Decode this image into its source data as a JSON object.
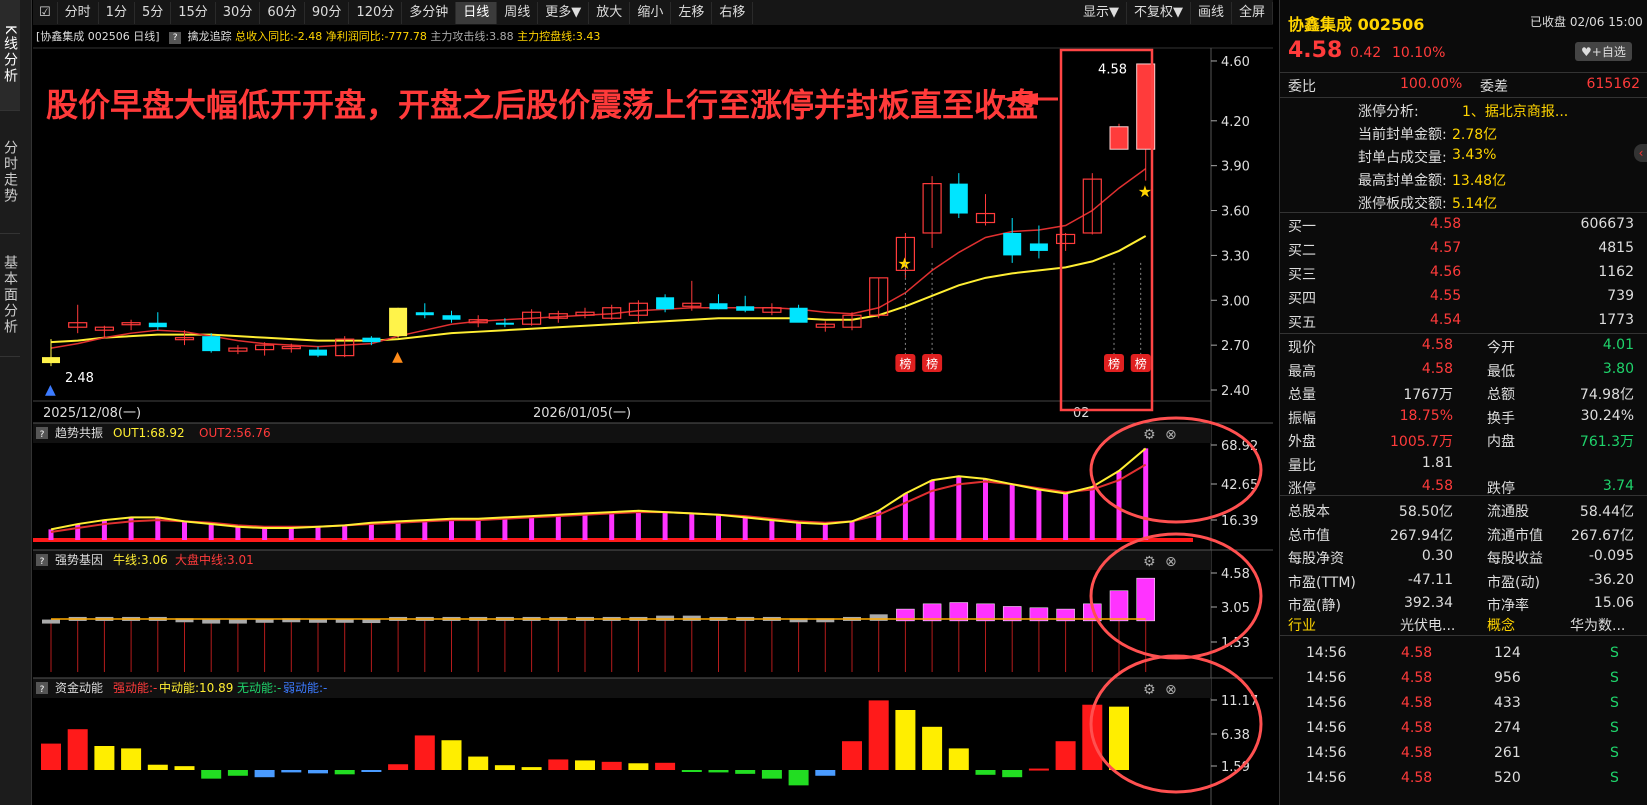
{
  "left_tabs": [
    "K线分析",
    "分时走势",
    "基本面分析"
  ],
  "toolbar": [
    "分时",
    "1分",
    "5分",
    "15分",
    "30分",
    "60分",
    "90分",
    "120分",
    "多分钟",
    "日线",
    "周线",
    "更多▼",
    "放大",
    "缩小",
    "左移",
    "右移"
  ],
  "toolbar_right": [
    "显示▼",
    "不复权▼",
    "画线",
    "全屏"
  ],
  "info": {
    "title": "[协鑫集成 002506 日线]",
    "indicator": "擒龙追踪",
    "t1": "总收入同比:-2.48",
    "t2": "净利润同比:-777.78",
    "t3": "主力攻击线:3.88",
    "t4": "主力控盘线:3.43"
  },
  "annotation": "股价早盘大幅低开开盘，开盘之后股价震荡上行至涨停并封板直至收盘",
  "price_axis": [
    "4.60",
    "4.20",
    "3.90",
    "3.60",
    "3.30",
    "3.00",
    "2.70",
    "2.40"
  ],
  "date_axis": [
    "2025/12/08(一)",
    "2026/01/05(一)",
    "02"
  ],
  "labels": {
    "low": "2.48",
    "high": "4.58",
    "bang": "榜"
  },
  "panels": [
    {
      "title": "趋势共振",
      "l1": "OUT1:68.92",
      "l2": "OUT2:56.76",
      "axis": [
        "68.92",
        "42.65",
        "16.39"
      ]
    },
    {
      "title": "强势基因",
      "l1": "牛线:3.06",
      "l2": "大盘中线:3.01",
      "axis": [
        "4.58",
        "3.05",
        "1.53"
      ]
    },
    {
      "title": "资金动能",
      "l1": "强动能:-",
      "l2": "中动能:10.89",
      "l3": "无动能:-",
      "l4": "弱动能:-",
      "axis": [
        "11.17",
        "6.38",
        "1.59"
      ]
    }
  ],
  "chart_data": {
    "type": "candlestick",
    "title": "协鑫集成 002506 日线",
    "candles": [
      [
        2.62,
        2.74,
        2.56,
        2.58
      ],
      [
        2.82,
        2.97,
        2.78,
        2.85
      ],
      [
        2.8,
        2.83,
        2.75,
        2.82
      ],
      [
        2.84,
        2.87,
        2.8,
        2.85
      ],
      [
        2.85,
        2.92,
        2.8,
        2.82
      ],
      [
        2.75,
        2.8,
        2.7,
        2.75
      ],
      [
        2.76,
        2.78,
        2.65,
        2.66
      ],
      [
        2.66,
        2.7,
        2.64,
        2.68
      ],
      [
        2.67,
        2.72,
        2.63,
        2.7
      ],
      [
        2.68,
        2.71,
        2.65,
        2.69
      ],
      [
        2.67,
        2.69,
        2.62,
        2.63
      ],
      [
        2.63,
        2.76,
        2.62,
        2.74
      ],
      [
        2.75,
        2.76,
        2.7,
        2.72
      ],
      [
        2.76,
        2.95,
        2.75,
        2.95
      ],
      [
        2.92,
        2.98,
        2.88,
        2.9
      ],
      [
        2.9,
        2.93,
        2.85,
        2.87
      ],
      [
        2.85,
        2.9,
        2.82,
        2.87
      ],
      [
        2.85,
        2.88,
        2.82,
        2.84
      ],
      [
        2.84,
        2.94,
        2.83,
        2.92
      ],
      [
        2.88,
        2.93,
        2.85,
        2.91
      ],
      [
        2.9,
        2.95,
        2.88,
        2.92
      ],
      [
        2.88,
        2.97,
        2.87,
        2.95
      ],
      [
        2.9,
        3.0,
        2.85,
        2.98
      ],
      [
        3.02,
        3.04,
        2.92,
        2.94
      ],
      [
        2.96,
        3.13,
        2.93,
        2.98
      ],
      [
        2.98,
        3.04,
        2.94,
        2.94
      ],
      [
        2.96,
        3.03,
        2.92,
        2.93
      ],
      [
        2.92,
        2.98,
        2.9,
        2.95
      ],
      [
        2.95,
        2.97,
        2.87,
        2.85
      ],
      [
        2.82,
        2.86,
        2.79,
        2.84
      ],
      [
        2.82,
        2.92,
        2.8,
        2.9
      ],
      [
        2.9,
        3.15,
        2.88,
        3.15
      ],
      [
        3.2,
        3.45,
        3.15,
        3.42
      ],
      [
        3.45,
        3.83,
        3.35,
        3.78
      ],
      [
        3.78,
        3.85,
        3.55,
        3.58
      ],
      [
        3.52,
        3.71,
        3.5,
        3.58
      ],
      [
        3.45,
        3.55,
        3.25,
        3.3
      ],
      [
        3.38,
        3.5,
        3.28,
        3.33
      ],
      [
        3.38,
        3.45,
        3.33,
        3.44
      ],
      [
        3.45,
        3.85,
        3.44,
        3.81
      ],
      [
        4.01,
        4.18,
        4.01,
        4.16
      ],
      [
        4.01,
        4.58,
        3.8,
        4.58
      ]
    ],
    "limit_up_days": [
      0,
      13
    ],
    "ma_short": [
      2.68,
      2.71,
      2.75,
      2.78,
      2.8,
      2.79,
      2.76,
      2.73,
      2.71,
      2.7,
      2.69,
      2.7,
      2.71,
      2.76,
      2.8,
      2.84,
      2.86,
      2.87,
      2.88,
      2.89,
      2.9,
      2.91,
      2.93,
      2.94,
      2.95,
      2.95,
      2.95,
      2.95,
      2.94,
      2.92,
      2.91,
      2.95,
      3.05,
      3.2,
      3.32,
      3.42,
      3.46,
      3.47,
      3.5,
      3.6,
      3.75,
      3.88
    ],
    "ma_long": [
      2.72,
      2.73,
      2.75,
      2.76,
      2.77,
      2.77,
      2.77,
      2.76,
      2.75,
      2.74,
      2.73,
      2.73,
      2.73,
      2.74,
      2.76,
      2.78,
      2.79,
      2.8,
      2.81,
      2.82,
      2.83,
      2.84,
      2.85,
      2.86,
      2.87,
      2.88,
      2.88,
      2.88,
      2.88,
      2.87,
      2.87,
      2.9,
      2.96,
      3.03,
      3.1,
      3.15,
      3.18,
      3.2,
      3.22,
      3.26,
      3.33,
      3.43
    ],
    "ylim": [
      2.36,
      4.66
    ],
    "trend_out1": [
      8,
      12,
      15,
      17,
      17,
      14,
      12,
      10,
      9,
      9,
      10,
      11,
      13,
      14,
      15,
      16,
      16,
      17,
      18,
      19,
      20,
      21,
      22,
      21,
      20,
      19,
      17,
      15,
      13,
      12,
      14,
      22,
      35,
      45,
      48,
      46,
      42,
      38,
      35,
      40,
      52,
      68.92
    ],
    "trend_out2": [
      6,
      9,
      12,
      14,
      15,
      14,
      13,
      11,
      10,
      10,
      10,
      11,
      12,
      13,
      14,
      15,
      15,
      16,
      17,
      18,
      19,
      20,
      21,
      21,
      20,
      19,
      18,
      16,
      14,
      13,
      14,
      19,
      28,
      37,
      42,
      44,
      42,
      39,
      36,
      38,
      45,
      56.76
    ],
    "gene_bars": [
      3.0,
      3.1,
      3.1,
      3.1,
      3.1,
      3.05,
      3.0,
      3.0,
      3.03,
      3.05,
      3.03,
      3.03,
      3.02,
      3.1,
      3.1,
      3.1,
      3.1,
      3.1,
      3.1,
      3.1,
      3.1,
      3.1,
      3.1,
      3.15,
      3.15,
      3.1,
      3.1,
      3.1,
      3.05,
      3.05,
      3.1,
      3.2,
      3.4,
      3.6,
      3.65,
      3.6,
      3.5,
      3.45,
      3.4,
      3.6,
      4.1,
      4.58
    ],
    "gene_high_from": 32,
    "flow_bars": [
      {
        "v": 5.5,
        "c": "red"
      },
      {
        "v": 8.5,
        "c": "red"
      },
      {
        "v": 5,
        "c": "yellow"
      },
      {
        "v": 4.5,
        "c": "yellow"
      },
      {
        "v": 1.1,
        "c": "yellow"
      },
      {
        "v": 0.8,
        "c": "yellow"
      },
      {
        "v": -1.8,
        "c": "green"
      },
      {
        "v": -1.2,
        "c": "green"
      },
      {
        "v": -1.5,
        "c": "blue"
      },
      {
        "v": -0.5,
        "c": "blue"
      },
      {
        "v": -0.7,
        "c": "blue"
      },
      {
        "v": -0.9,
        "c": "green"
      },
      {
        "v": -0.4,
        "c": "blue"
      },
      {
        "v": 1.2,
        "c": "red"
      },
      {
        "v": 7.2,
        "c": "red"
      },
      {
        "v": 6.2,
        "c": "yellow"
      },
      {
        "v": 2.8,
        "c": "yellow"
      },
      {
        "v": 1.0,
        "c": "yellow"
      },
      {
        "v": 0.6,
        "c": "yellow"
      },
      {
        "v": 2.2,
        "c": "red"
      },
      {
        "v": 2.0,
        "c": "yellow"
      },
      {
        "v": 1.7,
        "c": "red"
      },
      {
        "v": 1.4,
        "c": "yellow"
      },
      {
        "v": 1.5,
        "c": "red"
      },
      {
        "v": -0.3,
        "c": "green"
      },
      {
        "v": -0.5,
        "c": "green"
      },
      {
        "v": -0.8,
        "c": "green"
      },
      {
        "v": -1.8,
        "c": "green"
      },
      {
        "v": -3.2,
        "c": "green"
      },
      {
        "v": -1.2,
        "c": "blue"
      },
      {
        "v": 6.0,
        "c": "red"
      },
      {
        "v": 14.5,
        "c": "red"
      },
      {
        "v": 12.5,
        "c": "yellow"
      },
      {
        "v": 9.0,
        "c": "yellow"
      },
      {
        "v": 4.5,
        "c": "yellow"
      },
      {
        "v": -1.0,
        "c": "green"
      },
      {
        "v": -1.5,
        "c": "green"
      },
      {
        "v": 0.3,
        "c": "red"
      },
      {
        "v": 6.0,
        "c": "red"
      },
      {
        "v": 13.6,
        "c": "red"
      },
      {
        "v": 13.2,
        "c": "yellow"
      },
      {
        "v": 0.0,
        "c": "none"
      }
    ]
  },
  "quote": {
    "name": "协鑫集成 002506",
    "status": "已收盘 02/06 15:00",
    "price": "4.58",
    "change": "0.42",
    "pct": "10.10%",
    "watch": "+自选",
    "webi_label": "委比",
    "webi": "100.00%",
    "weicha_label": "委差",
    "weicha": "615162",
    "limit_info": [
      [
        "涨停分析:",
        "1、据北京商报..."
      ],
      [
        "当前封单金额:",
        "2.78亿"
      ],
      [
        "封单占成交量:",
        "3.43%"
      ],
      [
        "最高封单金额:",
        "13.48亿"
      ],
      [
        "涨停板成交额:",
        "5.14亿"
      ]
    ],
    "buy": [
      [
        "买一",
        "4.58",
        "606673"
      ],
      [
        "买二",
        "4.57",
        "4815"
      ],
      [
        "买三",
        "4.56",
        "1162"
      ],
      [
        "买四",
        "4.55",
        "739"
      ],
      [
        "买五",
        "4.54",
        "1773"
      ]
    ],
    "stats": [
      [
        [
          "现价",
          "4.58",
          "red"
        ],
        [
          "今开",
          "4.01",
          "green"
        ]
      ],
      [
        [
          "最高",
          "4.58",
          "red"
        ],
        [
          "最低",
          "3.80",
          "green"
        ]
      ],
      [
        [
          "总量",
          "1767万",
          "white"
        ],
        [
          "总额",
          "74.98亿",
          "white"
        ]
      ],
      [
        [
          "振幅",
          "18.75%",
          "red"
        ],
        [
          "换手",
          "30.24%",
          "white"
        ]
      ],
      [
        [
          "外盘",
          "1005.7万",
          "red"
        ],
        [
          "内盘",
          "761.3万",
          "green"
        ]
      ],
      [
        [
          "量比",
          "1.81",
          "white"
        ],
        [
          "",
          "",
          " "
        ]
      ],
      [
        [
          "涨停",
          "4.58",
          "red"
        ],
        [
          "跌停",
          "3.74",
          "green"
        ]
      ]
    ],
    "fund": [
      [
        [
          "总股本",
          "58.50亿"
        ],
        [
          "流通股",
          "58.44亿"
        ]
      ],
      [
        [
          "总市值",
          "267.94亿"
        ],
        [
          "流通市值",
          "267.67亿"
        ]
      ],
      [
        [
          "每股净资",
          "0.30"
        ],
        [
          "每股收益",
          "-0.095"
        ]
      ],
      [
        [
          "市盈(TTM)",
          "-47.11"
        ],
        [
          "市盈(动)",
          "-36.20"
        ]
      ],
      [
        [
          "市盈(静)",
          "392.34"
        ],
        [
          "市净率",
          "15.06"
        ]
      ]
    ],
    "industry": [
      [
        "行业",
        "光伏电..."
      ],
      [
        "概念",
        "华为数..."
      ]
    ],
    "ticks": [
      [
        "14:56",
        "4.58",
        "124",
        "S"
      ],
      [
        "14:56",
        "4.58",
        "956",
        "S"
      ],
      [
        "14:56",
        "4.58",
        "433",
        "S"
      ],
      [
        "14:56",
        "4.58",
        "274",
        "S"
      ],
      [
        "14:56",
        "4.58",
        "261",
        "S"
      ],
      [
        "14:56",
        "4.58",
        "520",
        "S"
      ]
    ]
  }
}
